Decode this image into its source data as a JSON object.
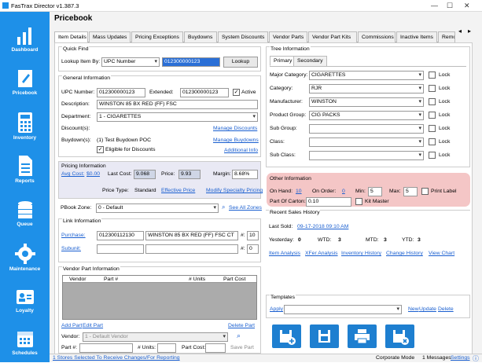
{
  "window": {
    "title": "FasTrax Director v1.387.3"
  },
  "sidebar": {
    "items": [
      {
        "label": "Dashboard"
      },
      {
        "label": "Pricebook"
      },
      {
        "label": "Inventory"
      },
      {
        "label": "Reports"
      },
      {
        "label": "Queue"
      },
      {
        "label": "Maintenance"
      },
      {
        "label": "Loyalty"
      },
      {
        "label": "Schedules"
      }
    ]
  },
  "page_title": "Pricebook",
  "tabs": [
    "Item Details",
    "Mass Updates",
    "Pricing Exceptions",
    "Buydowns",
    "System Discounts",
    "Vendor Parts",
    "Vendor Part Kits",
    "Commissions",
    "Inactive Items",
    "Remote S"
  ],
  "quick_find": {
    "title": "Quick Find",
    "lookup_label": "Lookup Item By:",
    "lookup_by": "UPC Number",
    "lookup_value": "012300000123",
    "lookup_button": "Lookup"
  },
  "general": {
    "title": "General Information",
    "upc_label": "UPC Number:",
    "upc": "012300000123",
    "extended_label": "Extended:",
    "extended": "012300000123",
    "active_label": "Active",
    "description_label": "Description:",
    "description": "WINSTON 85 BX RED (FF) FSC",
    "department_label": "Department:",
    "department": "1 - CIGARETTES",
    "discounts_label": "Discount(s):",
    "manage_discounts": "Manage Discounts",
    "buydowns_label": "Buydown(s):",
    "buydown_value": "(1) Test Buydown POC",
    "manage_buydowns": "Manage Buydowns",
    "eligible_label": "Eligible for Discounts",
    "additional_info": "Additional Info"
  },
  "pricing": {
    "title": "Pricing Information",
    "avg_cost_label": "Avg Cost:",
    "avg_cost": "$0.00",
    "last_cost_label": "Last Cost:",
    "last_cost": "9.068",
    "price_label": "Price:",
    "price": "9.93",
    "margin_label": "Margin:",
    "margin": "8.68%",
    "price_type_label": "Price Type:",
    "price_type": "Standard",
    "effective_price": "Effective Price",
    "modify_specialty": "Modify Specialty Pricing",
    "pbook_zone_label": "PBook Zone:",
    "pbook_zone": "0 - Default",
    "see_all_zones": "See All Zones"
  },
  "link_info": {
    "title": "Link Information",
    "purchase_label": "Purchase:",
    "purchase_upc": "012300112130",
    "purchase_desc": "WINSTON 85 BX RED (FF) FSC CT",
    "purchase_qty_label": "#:",
    "purchase_qty": "10",
    "subunit_label": "Subunit:",
    "subunit_qty_label": "#:",
    "subunit_qty": "0"
  },
  "vendor_parts": {
    "title": "Vendor Part Information",
    "columns": [
      "Vendor",
      "Part #",
      "# Units",
      "Part Cost"
    ],
    "add_part": "Add Part",
    "edit_part": "Edit Part",
    "delete_part": "Delete Part",
    "vendor_label": "Vendor:",
    "vendor": "1 - Default Vendor",
    "part_label": "Part #:",
    "units_label": "# Units:",
    "part_cost_label": "Part Cost:",
    "save_part": "Save Part"
  },
  "tree": {
    "title": "Tree Information",
    "tabs": [
      "Primary",
      "Secondary"
    ],
    "rows": [
      {
        "label": "Major Category:",
        "value": "CIGARETTES"
      },
      {
        "label": "Category:",
        "value": "RJR"
      },
      {
        "label": "Manufacturer:",
        "value": "WINSTON"
      },
      {
        "label": "Product Group:",
        "value": "CIG PACKS"
      },
      {
        "label": "Sub Group:",
        "value": ""
      },
      {
        "label": "Class:",
        "value": ""
      },
      {
        "label": "Sub Class:",
        "value": ""
      }
    ],
    "lock_label": "Lock"
  },
  "other": {
    "title": "Other Information",
    "on_hand_label": "On Hand:",
    "on_hand": "10",
    "on_order_label": "On Order:",
    "on_order": "0",
    "min_label": "Min:",
    "min": "5",
    "max_label": "Max:",
    "max": "5",
    "print_label": "Print Label",
    "part_of_carton_label": "Part Of Carton:",
    "part_of_carton": "0.10",
    "kit_master": "Kit Master",
    "highlight_color": "#f4c6c6"
  },
  "sales": {
    "title": "Recent Sales History",
    "last_sold_label": "Last Sold:",
    "last_sold": "09-17-2018 09:10 AM",
    "yesterday_label": "Yesterday:",
    "yesterday": "0",
    "wtd_label": "WTD:",
    "wtd": "3",
    "mtd_label": "MTD:",
    "mtd": "3",
    "ytd_label": "YTD:",
    "ytd": "3",
    "links": [
      "Item Analysis",
      "XFer Analysis",
      "Inventory History",
      "Change History",
      "View Chart"
    ]
  },
  "templates": {
    "title": "Templates",
    "apply": "Apply",
    "new": "New",
    "update": "Update",
    "delete": "Delete"
  },
  "status": {
    "stores_link": "1 Stores Selected To Receive Changes/For Reporting",
    "mode": "Corporate Mode",
    "messages": "1 Messages",
    "settings": "Settings"
  },
  "colors": {
    "sidebar": "#1e90e8",
    "accent_button": "#1e7fd0",
    "link": "#1a5fd0"
  }
}
